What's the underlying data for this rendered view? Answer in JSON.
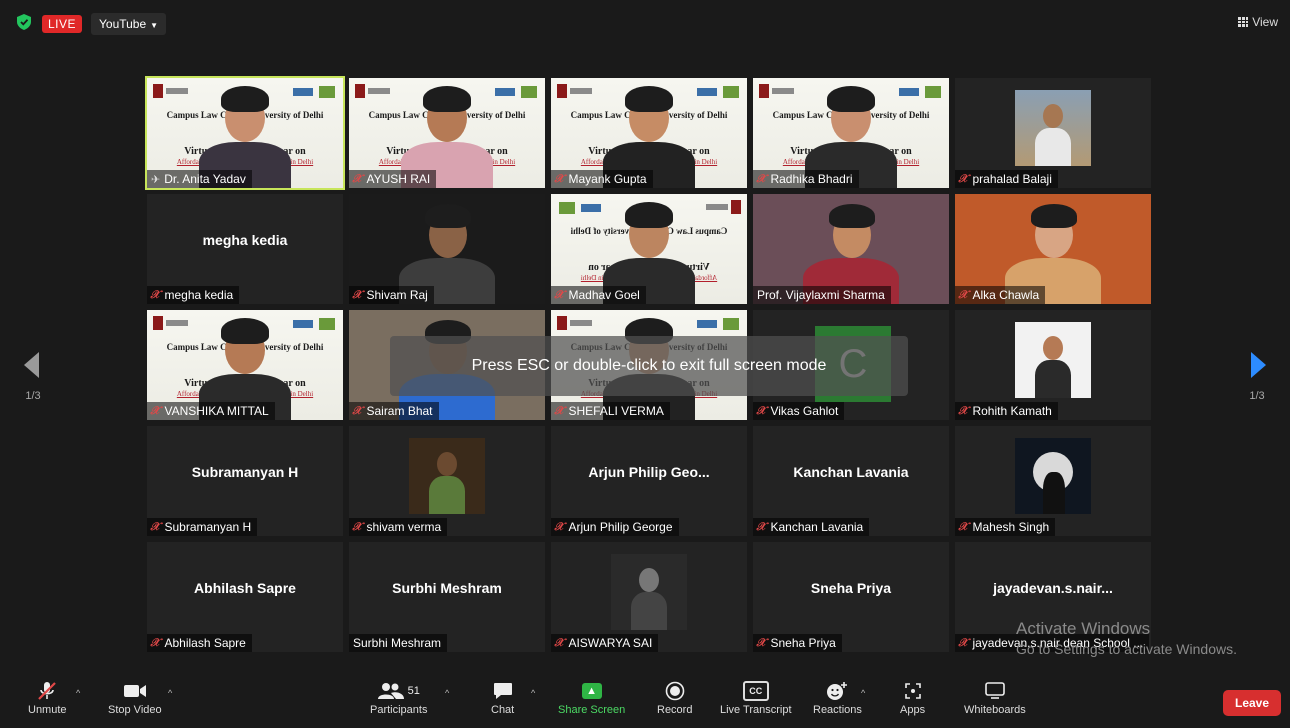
{
  "topbar": {
    "live_label": "LIVE",
    "stream_target": "YouTube",
    "view_label": "View"
  },
  "tiles": [
    {
      "name": "Dr. Anita Yadav",
      "muted": false,
      "pinned": true,
      "active": true,
      "video": "banner"
    },
    {
      "name": "AYUSH RAI",
      "muted": true,
      "video": "banner"
    },
    {
      "name": "Mayank Gupta",
      "muted": true,
      "video": "banner"
    },
    {
      "name": "Radhika Bhadri",
      "muted": true,
      "video": "banner"
    },
    {
      "name": "prahalad Balaji",
      "muted": true,
      "video": "thumb"
    },
    {
      "name": "megha kedia",
      "display": "megha kedia",
      "muted": true,
      "video": "none"
    },
    {
      "name": "Shivam Raj",
      "muted": true,
      "video": "camera"
    },
    {
      "name": "Madhav Goel",
      "muted": true,
      "video": "banner-flip"
    },
    {
      "name": "Prof. Vijaylaxmi Sharma",
      "muted": false,
      "video": "camera"
    },
    {
      "name": "Alka Chawla",
      "muted": true,
      "video": "camera"
    },
    {
      "name": "VANSHIKA MITTAL",
      "muted": true,
      "video": "banner"
    },
    {
      "name": "Sairam Bhat",
      "muted": true,
      "video": "camera"
    },
    {
      "name": "SHEFALI VERMA",
      "muted": true,
      "video": "banner"
    },
    {
      "name": "Vikas Gahlot",
      "muted": true,
      "video": "avatar",
      "avatar_letter": "C"
    },
    {
      "name": "Rohith Kamath",
      "muted": true,
      "video": "thumb"
    },
    {
      "name": "Subramanyan H",
      "display": "Subramanyan H",
      "muted": true,
      "video": "none"
    },
    {
      "name": "shivam verma",
      "muted": true,
      "video": "thumb"
    },
    {
      "name": "Arjun Philip George",
      "display": "Arjun Philip Geo...",
      "muted": true,
      "video": "none"
    },
    {
      "name": "Kanchan Lavania",
      "display": "Kanchan Lavania",
      "muted": true,
      "video": "none"
    },
    {
      "name": "Mahesh Singh",
      "muted": true,
      "video": "thumb"
    },
    {
      "name": "Abhilash Sapre",
      "display": "Abhilash Sapre",
      "muted": true,
      "video": "none"
    },
    {
      "name": "Surbhi Meshram",
      "display": "Surbhi Meshram",
      "muted": false,
      "video": "none"
    },
    {
      "name": "AISWARYA SAI",
      "muted": true,
      "video": "thumb"
    },
    {
      "name": "Sneha Priya",
      "display": "Sneha Priya",
      "muted": true,
      "video": "none"
    },
    {
      "name": "jayadevan.s.nair dean School ...",
      "display": "jayadevan.s.nair...",
      "muted": true,
      "video": "none"
    }
  ],
  "banner": {
    "line1": "Campus Law Centre, University of Delhi",
    "line2": "Virtual National Seminar on",
    "line3": "Affordable Shelter and Shelter Children in Delhi"
  },
  "overlay": {
    "message": "Press ESC or double-click to exit full screen mode"
  },
  "pager": {
    "left": "1/3",
    "right": "1/3"
  },
  "watermark": {
    "line1": "Activate Windows",
    "line2": "Go to Settings to activate Windows."
  },
  "toolbar": {
    "unmute": "Unmute",
    "stop_video": "Stop Video",
    "participants": "Participants",
    "participants_count": "51",
    "chat": "Chat",
    "share_screen": "Share Screen",
    "record": "Record",
    "live_transcript": "Live Transcript",
    "reactions": "Reactions",
    "apps": "Apps",
    "whiteboards": "Whiteboards",
    "leave": "Leave"
  },
  "colors": {
    "active_border": "#c7e55a",
    "live": "#e02828",
    "leave": "#d72f2f",
    "share": "#2fb545",
    "next_arrow": "#2d8cff"
  }
}
